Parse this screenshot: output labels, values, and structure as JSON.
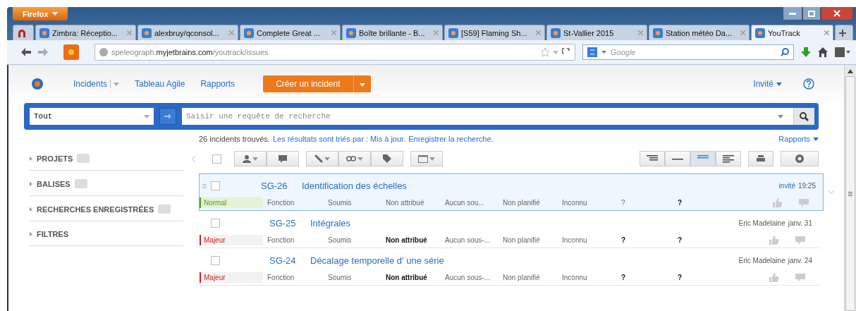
{
  "browser": {
    "menu_button": "Firefox",
    "tabs": [
      {
        "selected": false
      },
      {
        "label": "Zimbra: Réceptio...",
        "selected": false
      },
      {
        "label": "alexbruy/qconsol...",
        "selected": false
      },
      {
        "label": "Complete Great ...",
        "selected": false
      },
      {
        "label": "Boîte brillante - B...",
        "selected": false
      },
      {
        "label": "[S59] Flaming Sh...",
        "selected": false
      },
      {
        "label": "St-Vallier 2015",
        "selected": false
      },
      {
        "label": "Station météo Da...",
        "selected": false
      },
      {
        "label": "YouTrack",
        "selected": true
      }
    ],
    "url": {
      "host_prefix": "speleograph.",
      "host": "myjetbrains.com",
      "path": "/youtrack/issues"
    },
    "search_placeholder": "Google"
  },
  "header": {
    "nav": [
      "Incidents",
      "Tableau Agile",
      "Rapports"
    ],
    "create_button": "Créer un incident",
    "user": "Invité"
  },
  "search": {
    "context": "Tout",
    "placeholder": "Saisir une requête de recherche"
  },
  "results": {
    "count": "26 incidents trouvés.",
    "sort_link": "Les résultats sont triés par : Mis à jour.",
    "save_link": "Enregistrer la recherche.",
    "reports": "Rapports"
  },
  "sidebar": {
    "sections": [
      "PROJETS",
      "BALISES",
      "RECHERCHES ENREGISTRÉES",
      "FILTRES"
    ]
  },
  "select_all": {
    "checked": false
  },
  "view_modes": [
    {
      "selected": false
    },
    {
      "selected": false
    },
    {
      "selected": true
    },
    {
      "selected": false
    }
  ],
  "issues": [
    {
      "id": "SG-26",
      "title": "Identification des échelles",
      "selected": true,
      "author": "invité",
      "date": "19:25",
      "priority": {
        "text": "Normal",
        "color": "#5a9a1a"
      },
      "fields": [
        {
          "text": "Fonction",
          "emphasis": false
        },
        {
          "text": "Soumis",
          "emphasis": false
        },
        {
          "text": "Non attribué",
          "emphasis": false
        },
        {
          "text": "Aucun sou...",
          "emphasis": false
        },
        {
          "text": "Non planifié",
          "emphasis": false
        },
        {
          "text": "Inconnu",
          "emphasis": false
        },
        {
          "text": "?",
          "emphasis": false
        },
        {
          "text": "?",
          "emphasis": true
        }
      ]
    },
    {
      "id": "SG-25",
      "title": "Intégrales",
      "selected": false,
      "author": "Eric Madelaine",
      "date": "janv. 31",
      "priority": {
        "text": "Majeur",
        "color": "#cc2222"
      },
      "fields": [
        {
          "text": "Fonction",
          "emphasis": false
        },
        {
          "text": "Soumis",
          "emphasis": false
        },
        {
          "text": "Non attribué",
          "emphasis": true
        },
        {
          "text": "Aucun sous-...",
          "emphasis": false
        },
        {
          "text": "Non planifié",
          "emphasis": false
        },
        {
          "text": "Inconnu",
          "emphasis": false
        },
        {
          "text": "?",
          "emphasis": true
        },
        {
          "text": "?",
          "emphasis": true
        }
      ]
    },
    {
      "id": "SG-24",
      "title": "Décalage temporelle d' une série",
      "selected": false,
      "author": "Eric Madelaine",
      "date": "janv. 24",
      "priority": {
        "text": "Majeur",
        "color": "#cc2222"
      },
      "fields": [
        {
          "text": "Fonction",
          "emphasis": false
        },
        {
          "text": "Soumis",
          "emphasis": false
        },
        {
          "text": "Non attribué",
          "emphasis": true
        },
        {
          "text": "Aucun sous-...",
          "emphasis": false
        },
        {
          "text": "Non planifié",
          "emphasis": false
        },
        {
          "text": "Inconnu",
          "emphasis": false
        },
        {
          "text": "?",
          "emphasis": true
        },
        {
          "text": "?",
          "emphasis": true
        }
      ]
    }
  ]
}
